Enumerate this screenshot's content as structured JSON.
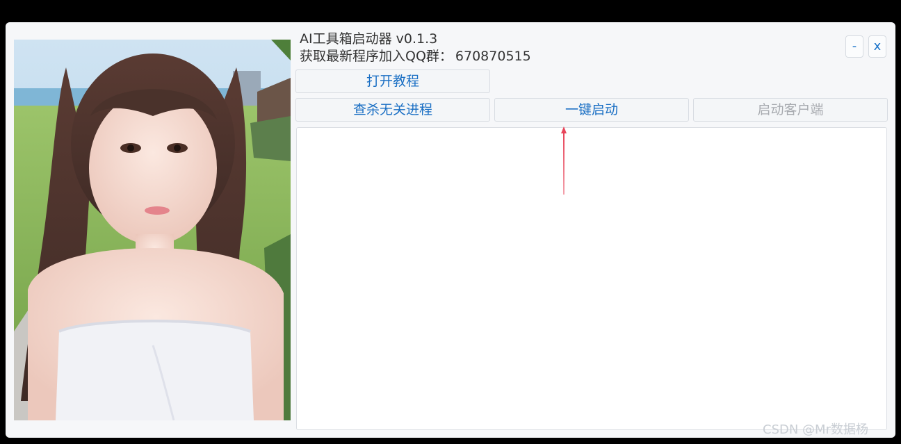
{
  "window": {
    "title": "AI工具箱启动器 v0.1.3",
    "subtitle_label": "获取最新程序加入QQ群：",
    "subtitle_value": "670870515",
    "minimize_label": "-",
    "close_label": "x"
  },
  "toolbar": {
    "tutorial_label": "打开教程",
    "kill_label": "查杀无关进程",
    "launch_label": "一键启动",
    "client_label": "启动客户端"
  },
  "colors": {
    "accent": "#1a6fc4",
    "disabled": "#a8abb0",
    "annotation_arrow": "#e8455a"
  },
  "watermark": "CSDN @Mr数据杨"
}
